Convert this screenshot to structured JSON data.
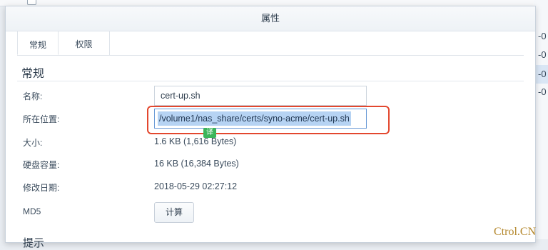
{
  "dialog": {
    "title": "属性",
    "tabs": [
      {
        "label": "常规"
      },
      {
        "label": "权限"
      }
    ],
    "section_title": "常规",
    "fields": {
      "name": {
        "label": "名称:",
        "value": "cert-up.sh"
      },
      "location": {
        "label": "所在位置:",
        "value": "/volume1/nas_share/certs/syno-acme/cert-up.sh"
      },
      "size": {
        "label": "大小:",
        "value": "1.6 KB (1,616 Bytes)"
      },
      "disk_size": {
        "label": "硬盘容量:",
        "value": "16 KB (16,384 Bytes)"
      },
      "modified": {
        "label": "修改日期:",
        "value": "2018-05-29 02:27:12"
      },
      "md5": {
        "label": "MD5",
        "button_label": "计算"
      }
    },
    "next_section_title": "提示"
  },
  "translate_badge": "译",
  "background_rows": [
    "-0",
    "-0",
    "-0",
    "-0"
  ],
  "watermark": "Ctrol.CN",
  "colors": {
    "highlight_border": "#e3472e",
    "selection": "#b6d3f3",
    "translate_badge": "#3cb55a"
  }
}
